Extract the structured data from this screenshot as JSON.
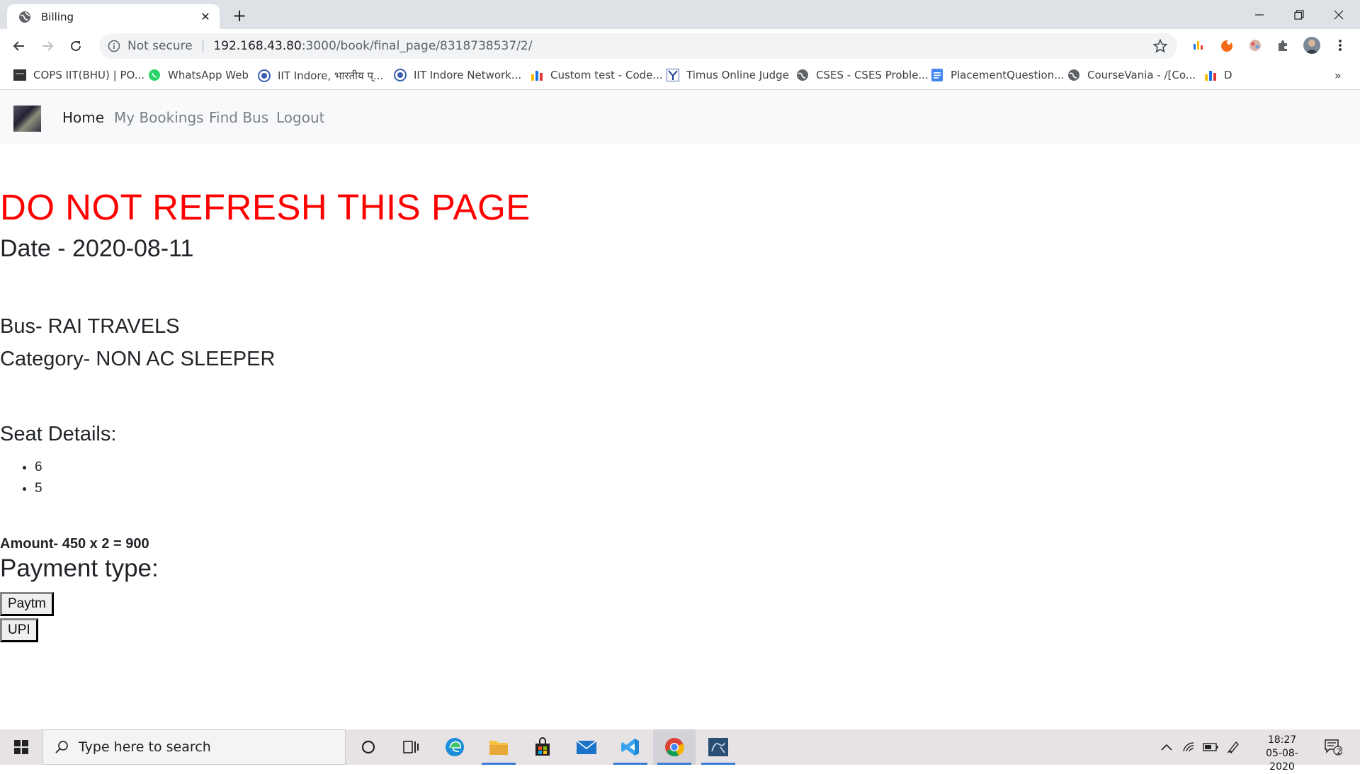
{
  "browser": {
    "tab_title": "Billing",
    "url_security": "Not secure",
    "url_host": "192.168.43.80",
    "url_path": ":3000/book/final_page/8318738537/2/",
    "bookmarks": [
      "COPS IIT(BHU) | PO...",
      "WhatsApp Web",
      "IIT Indore, भारतीय प्...",
      "IIT Indore Network...",
      "Custom test - Code...",
      "Timus Online Judge",
      "CSES - CSES Proble...",
      "PlacementQuestion...",
      "CourseVania - /[Co...",
      "D"
    ],
    "bookmarks_overflow": "»"
  },
  "navbar": {
    "home": "Home",
    "my_bookings": "My Bookings",
    "find_bus": "Find Bus",
    "logout": "Logout"
  },
  "billing": {
    "warning": "DO NOT REFRESH THIS PAGE",
    "date": "Date - 2020-08-11",
    "bus": "Bus- RAI TRAVELS",
    "category": "Category- NON AC SLEEPER",
    "seat_heading": "Seat Details:",
    "seats": [
      "6",
      "5"
    ],
    "amount": "Amount- 450 x 2 = 900",
    "payment_heading": "Payment type:",
    "payment_options": [
      "Paytm",
      "UPI"
    ]
  },
  "taskbar": {
    "search_placeholder": "Type here to search",
    "time": "18:27",
    "date": "05-08-2020",
    "notification_count": "2"
  }
}
